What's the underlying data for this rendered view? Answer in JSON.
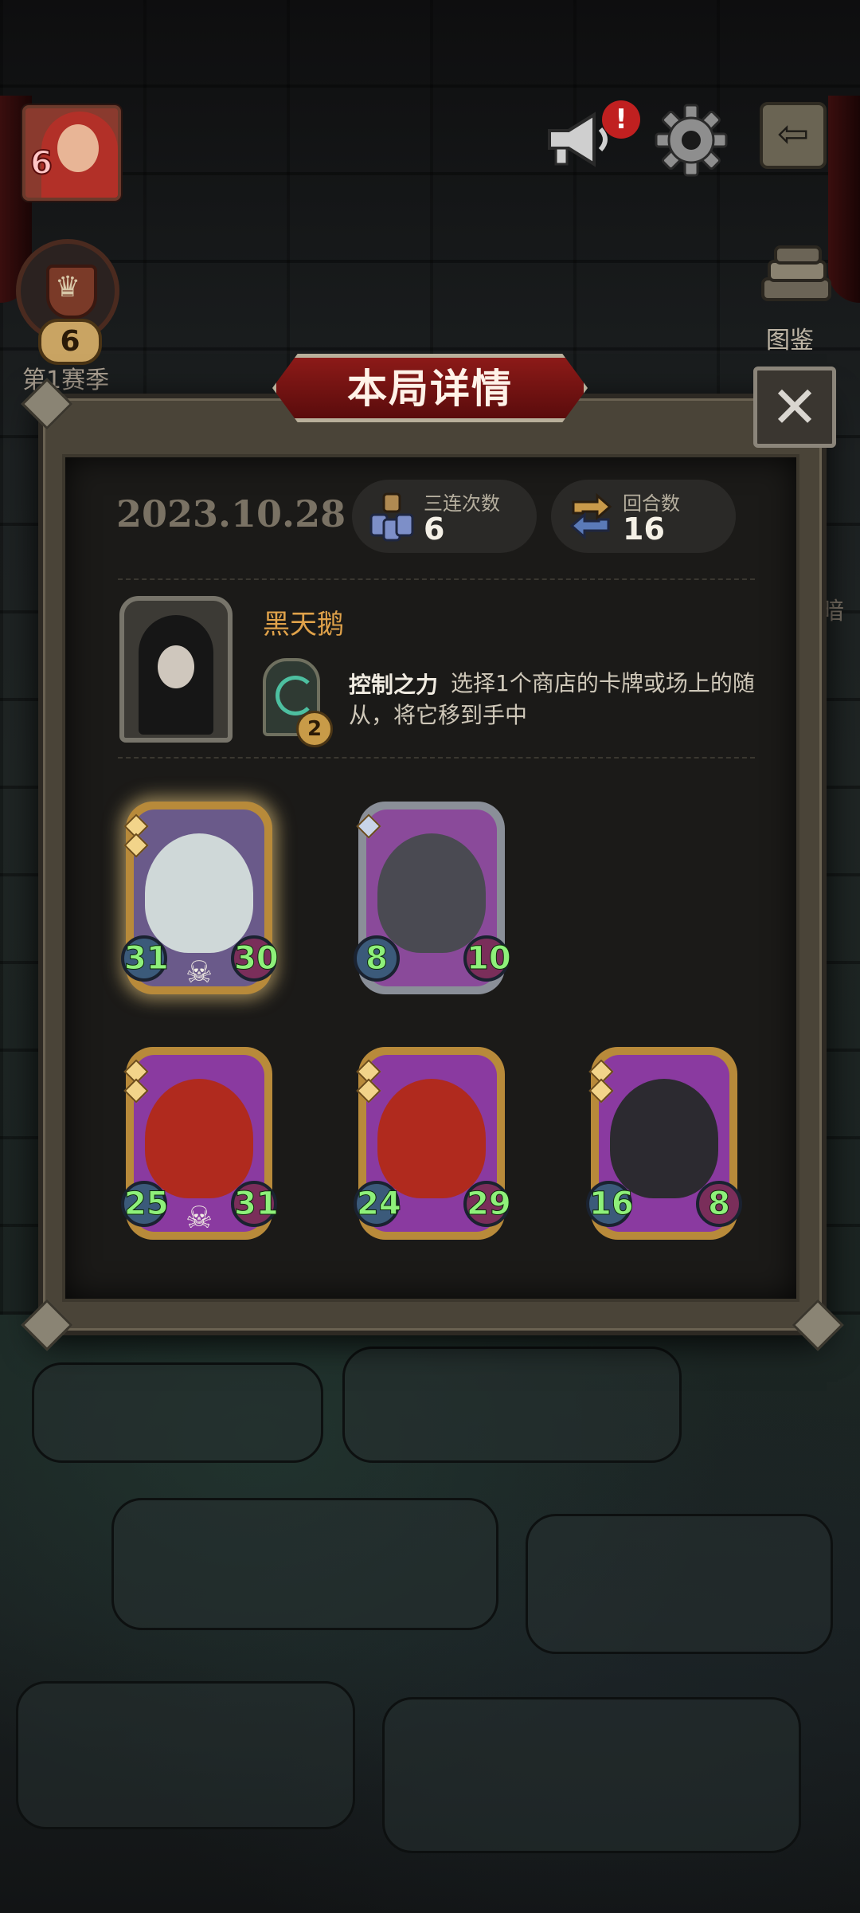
{
  "hud": {
    "player_level": "6",
    "rank_level": "6",
    "season_label": "第1赛季",
    "notification_badge": "!",
    "exit_glyph": "⇦",
    "codex_label": "图鉴",
    "side_peek_text": "暗"
  },
  "modal": {
    "title": "本局详情",
    "close_glyph": "✕",
    "date": "2023.10.28",
    "stats": {
      "triples_label": "三连次数",
      "triples_value": "6",
      "rounds_label": "回合数",
      "rounds_value": "16"
    },
    "hero": {
      "name": "黑天鹅",
      "power_cost": "2",
      "power_name": "控制之力",
      "power_desc": "选择1个商店的卡牌或场上的随从，将它移到手中"
    },
    "minions": [
      {
        "attack": "31",
        "health": "30",
        "frame": "gold",
        "glow": true,
        "skull": true
      },
      {
        "attack": "8",
        "health": "10",
        "frame": "silver",
        "glow": false,
        "skull": false
      },
      {
        "attack": "25",
        "health": "31",
        "frame": "gold",
        "glow": false,
        "skull": true
      },
      {
        "attack": "24",
        "health": "29",
        "frame": "gold",
        "glow": false,
        "skull": false
      },
      {
        "attack": "16",
        "health": "8",
        "frame": "gold",
        "glow": false,
        "skull": false
      }
    ]
  },
  "colors": {
    "title_plate": "#8c1a18",
    "hero_name": "#e0a24a",
    "stat_green": "#8ef07a"
  }
}
